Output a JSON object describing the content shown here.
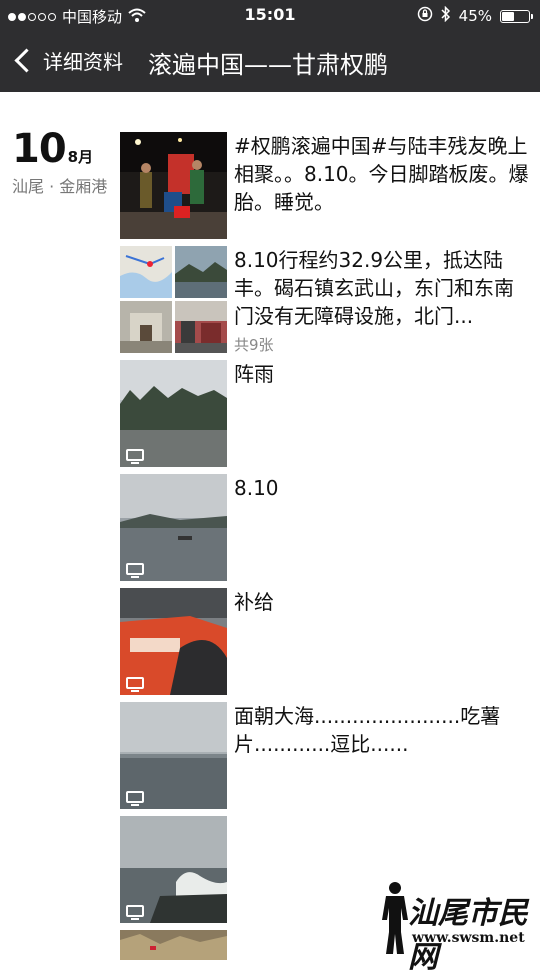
{
  "status_bar": {
    "carrier": "中国移动",
    "time": "15:01",
    "battery": "45%",
    "battery_level": 0.45,
    "signal_dots": [
      true,
      true,
      false,
      false,
      false
    ],
    "icons": [
      "wifi-icon",
      "orientation-lock-icon",
      "bluetooth-icon",
      "battery-icon"
    ]
  },
  "nav": {
    "back_label": "详细资料",
    "title": "滚遍中国——甘肃权鹏"
  },
  "date": {
    "day": "10",
    "month": "8月",
    "location": "汕尾 · 金厢港"
  },
  "posts": [
    {
      "text": "#权鹏滚遍中国#与陆丰残友晚上相聚。。8.10。今日脚踏板废。爆胎。睡觉。",
      "type": "photo"
    },
    {
      "text": "8.10行程约32.9公里，抵达陆丰。碣石镇玄武山，东门和东南门没有无障碍设施，北门...",
      "count": "共9张",
      "type": "album"
    },
    {
      "text": "阵雨",
      "type": "video"
    },
    {
      "text": "8.10",
      "type": "video"
    },
    {
      "text": "补给",
      "type": "video"
    },
    {
      "text": "面朝大海.......................吃薯片............逗比......",
      "type": "video"
    },
    {
      "text": "",
      "type": "video"
    },
    {
      "text": "",
      "type": "photo"
    }
  ],
  "watermark": {
    "name": "汕尾市民网",
    "url": "www.swsm.net"
  }
}
